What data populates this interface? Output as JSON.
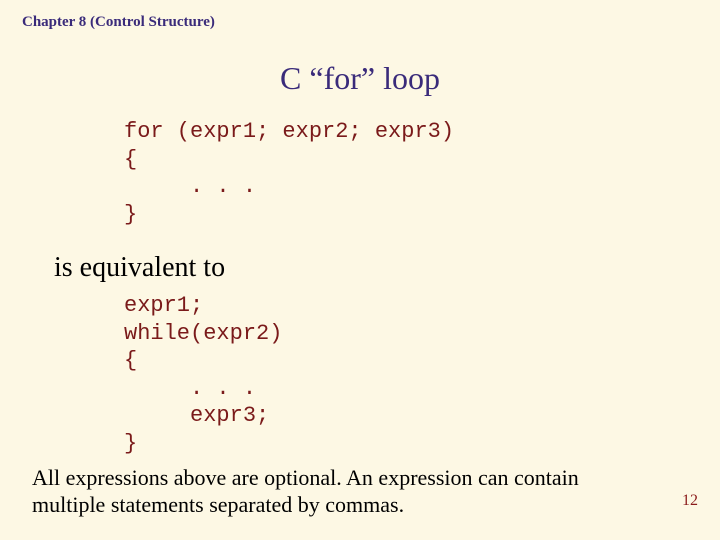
{
  "header": "Chapter 8 (Control Structure)",
  "title": "C “for” loop",
  "code1": "for (expr1; expr2; expr3)\n{\n     . . .\n}",
  "equiv": "is equivalent to",
  "code2": "expr1;\nwhile(expr2)\n{\n     . . .\n     expr3;\n}",
  "footer": "All expressions above are optional.  An expression can contain multiple statements separated by commas.",
  "page": "12"
}
